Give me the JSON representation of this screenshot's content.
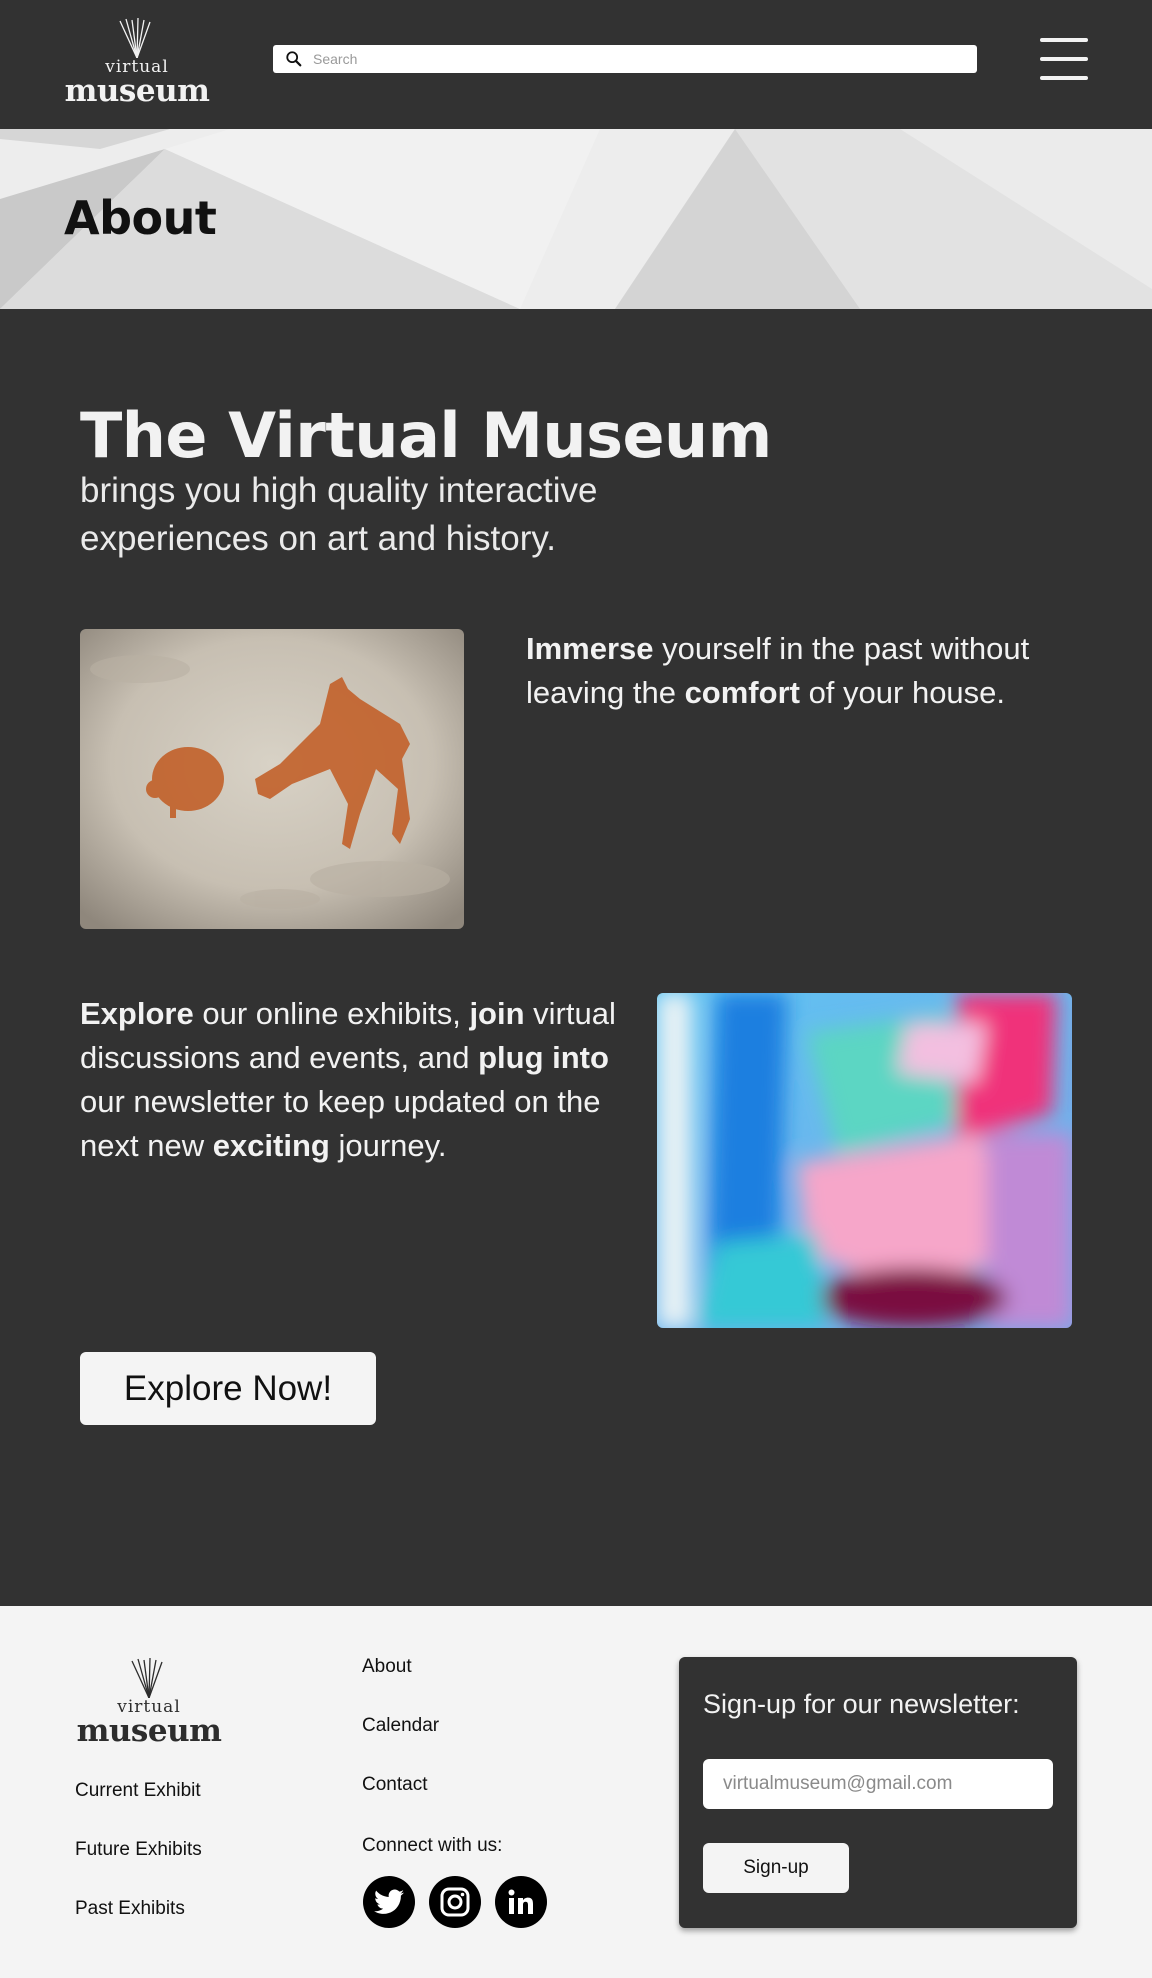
{
  "header": {
    "logo": {
      "small": "virtual",
      "big": "museum"
    },
    "search": {
      "placeholder": "Search",
      "icon": "search-icon"
    },
    "menu_icon": "hamburger-menu-icon"
  },
  "banner": {
    "title": "About"
  },
  "main": {
    "title": "The Virtual Museum",
    "subtitle": "brings you high quality interactive experiences on art and history.",
    "paragraph1": {
      "w1": "Immerse",
      "t1": " yourself in the past without leaving the ",
      "w2": "comfort",
      "t2": " of your house."
    },
    "paragraph2": {
      "w1": "Explore",
      "t1": " our online exhibits, ",
      "w2": "join",
      "t2": " virtual discussions and events, and ",
      "w3": "plug into",
      "t3": " our newsletter to keep updated on the next new ",
      "w4": "exciting",
      "t4": " journey."
    },
    "explore_button": "Explore Now!"
  },
  "footer": {
    "logo": {
      "small": "virtual",
      "big": "museum"
    },
    "col1": [
      "Current Exhibit",
      "Future Exhibits",
      "Past Exhibits"
    ],
    "col2": [
      "About",
      "Calendar",
      "Contact"
    ],
    "connect": "Connect with us:",
    "social_icons": [
      "twitter-icon",
      "instagram-icon",
      "linkedin-icon"
    ],
    "newsletter": {
      "title": "Sign-up for our newsletter:",
      "email_placeholder": "virtualmuseum@gmail.com",
      "button": "Sign-up"
    }
  },
  "colors": {
    "dark": "#323232",
    "light": "#f4f4f4",
    "text_dark": "#111111"
  }
}
